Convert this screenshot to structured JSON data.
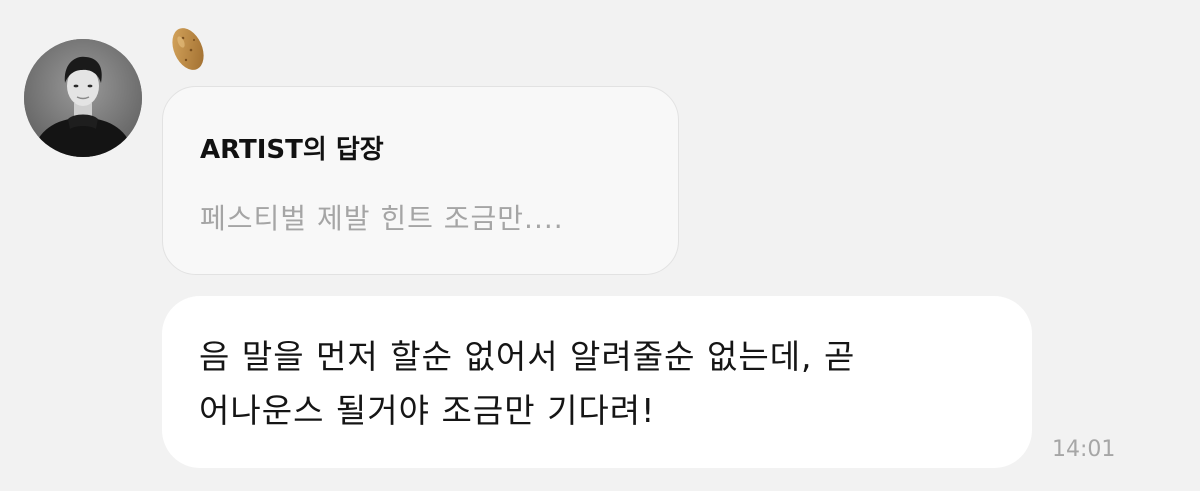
{
  "sender": {
    "avatar_icon": "artist-profile-photo",
    "reaction_icon": "potato-emoji-icon"
  },
  "reply": {
    "title": "ARTIST의 답장",
    "quoted_text": "페스티벌 제발 힌트 조금만...."
  },
  "message": {
    "lines": [
      "음 말을 먼저 할순 없어서 알려줄순 없는데, 곧",
      "어나운스 될거야 조금만 기다려!"
    ],
    "timestamp": "14:01"
  },
  "colors": {
    "background": "#f2f2f2",
    "bubble": "#ffffff",
    "reply_bubble": "#f8f8f8",
    "muted_text": "#a5a5a5"
  }
}
